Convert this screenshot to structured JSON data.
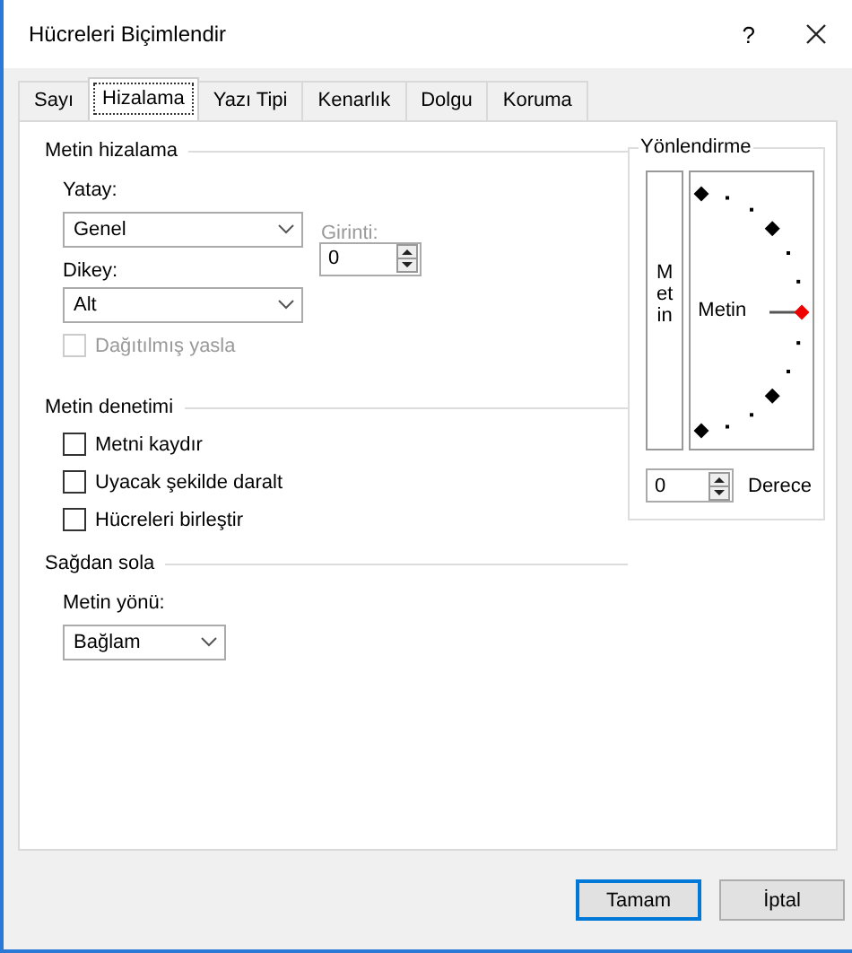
{
  "window": {
    "title": "Hücreleri Biçimlendir",
    "help": "?"
  },
  "tabs": [
    {
      "label": "Sayı",
      "selected": false
    },
    {
      "label": "Hizalama",
      "selected": true
    },
    {
      "label": "Yazı Tipi",
      "selected": false
    },
    {
      "label": "Kenarlık",
      "selected": false
    },
    {
      "label": "Dolgu",
      "selected": false
    },
    {
      "label": "Koruma",
      "selected": false
    }
  ],
  "alignment": {
    "heading": "Metin hizalama",
    "horizontal": {
      "label": "Yatay:",
      "value": "Genel"
    },
    "indent": {
      "label": "Girinti:",
      "value": "0",
      "disabled": true
    },
    "vertical": {
      "label": "Dikey:",
      "value": "Alt"
    },
    "distributed": {
      "label": "Dağıtılmış yasla",
      "checked": false,
      "disabled": true
    }
  },
  "text_control": {
    "heading": "Metin denetimi",
    "options": [
      {
        "label": "Metni kaydır",
        "checked": false
      },
      {
        "label": "Uyacak şekilde daralt",
        "checked": false
      },
      {
        "label": "Hücreleri birleştir",
        "checked": false
      }
    ]
  },
  "right_to_left": {
    "heading": "Sağdan sola",
    "direction": {
      "label": "Metin yönü:",
      "value": "Bağlam"
    }
  },
  "orientation": {
    "heading": "Yönlendirme",
    "vertical_text": "Metin",
    "dial_label": "Metin",
    "degrees": {
      "value": "0",
      "label": "Derece"
    }
  },
  "buttons": [
    {
      "label": "Tamam",
      "default": true
    },
    {
      "label": "İptal",
      "default": false
    }
  ]
}
